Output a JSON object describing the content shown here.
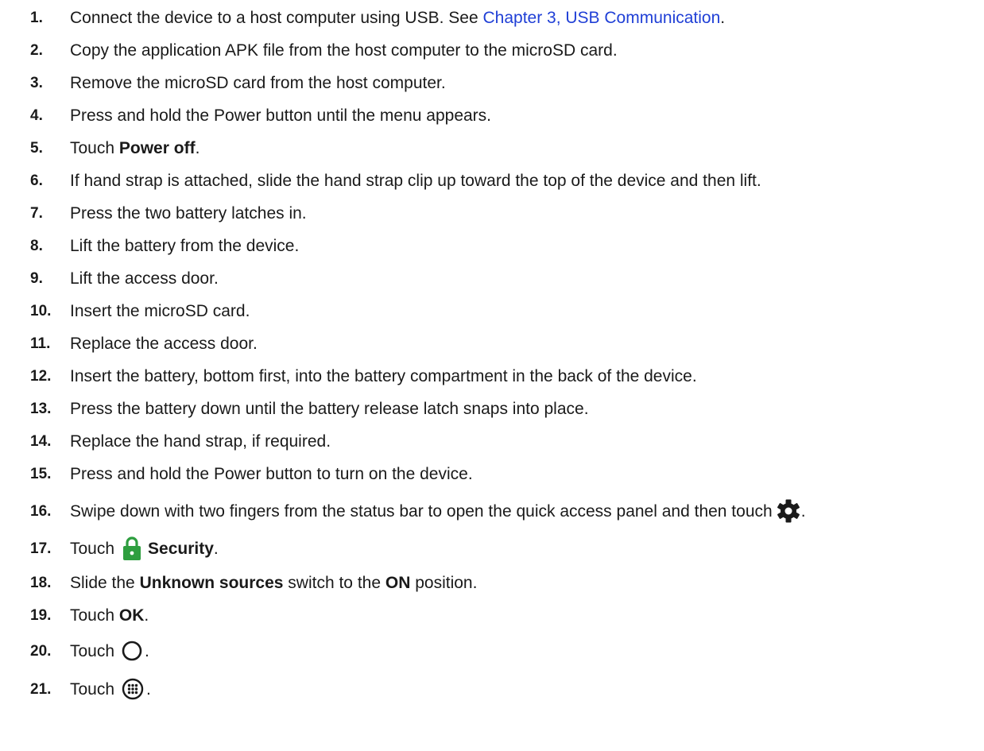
{
  "steps": [
    {
      "num": "1.",
      "text": "Connect the device to a host computer using USB. See ",
      "link": "Chapter 3, USB Communication",
      "after": "."
    },
    {
      "num": "2.",
      "text": "Copy the application APK file from the host computer to the microSD card."
    },
    {
      "num": "3.",
      "text": "Remove the microSD card from the host computer."
    },
    {
      "num": "4.",
      "text": "Press and hold the Power button until the menu appears."
    },
    {
      "num": "5.",
      "pre": "Touch ",
      "bold": "Power off",
      "post": "."
    },
    {
      "num": "6.",
      "text": "If hand strap is attached, slide the hand strap clip up toward the top of the device and then lift."
    },
    {
      "num": "7.",
      "text": "Press the two battery latches in."
    },
    {
      "num": "8.",
      "text": "Lift the battery from the device."
    },
    {
      "num": "9.",
      "text": "Lift the access door."
    },
    {
      "num": "10.",
      "text": "Insert the microSD card."
    },
    {
      "num": "11.",
      "text": "Replace the access door."
    },
    {
      "num": "12.",
      "text": "Insert the battery, bottom first, into the battery compartment in the back of the device."
    },
    {
      "num": "13.",
      "text": "Press the battery down until the battery release latch snaps into place."
    },
    {
      "num": "14.",
      "text": "Replace the hand strap, if required."
    },
    {
      "num": "15.",
      "text": "Press and hold the Power button to turn on the device."
    },
    {
      "num": "16.",
      "text": "Swipe down with two fingers from the status bar to open the quick access panel and then touch",
      "icon": "gear-icon",
      "post": "."
    },
    {
      "num": "17.",
      "pre": "Touch",
      "icon": "lock-icon",
      "bold": "Security",
      "post": "."
    },
    {
      "num": "18.",
      "pre": "Slide the ",
      "bold": "Unknown sources",
      "mid": " switch to the ",
      "bold2": "ON",
      "post": " position."
    },
    {
      "num": "19.",
      "pre": "Touch ",
      "bold": "OK",
      "post": "."
    },
    {
      "num": "20.",
      "pre": "Touch",
      "icon": "home-circle-icon",
      "post": "."
    },
    {
      "num": "21.",
      "pre": "Touch",
      "icon": "app-drawer-icon",
      "post": "."
    }
  ],
  "colors": {
    "link": "#1f3fd6",
    "lock_icon": "#2e9e3f",
    "text": "#1a1a1a"
  }
}
